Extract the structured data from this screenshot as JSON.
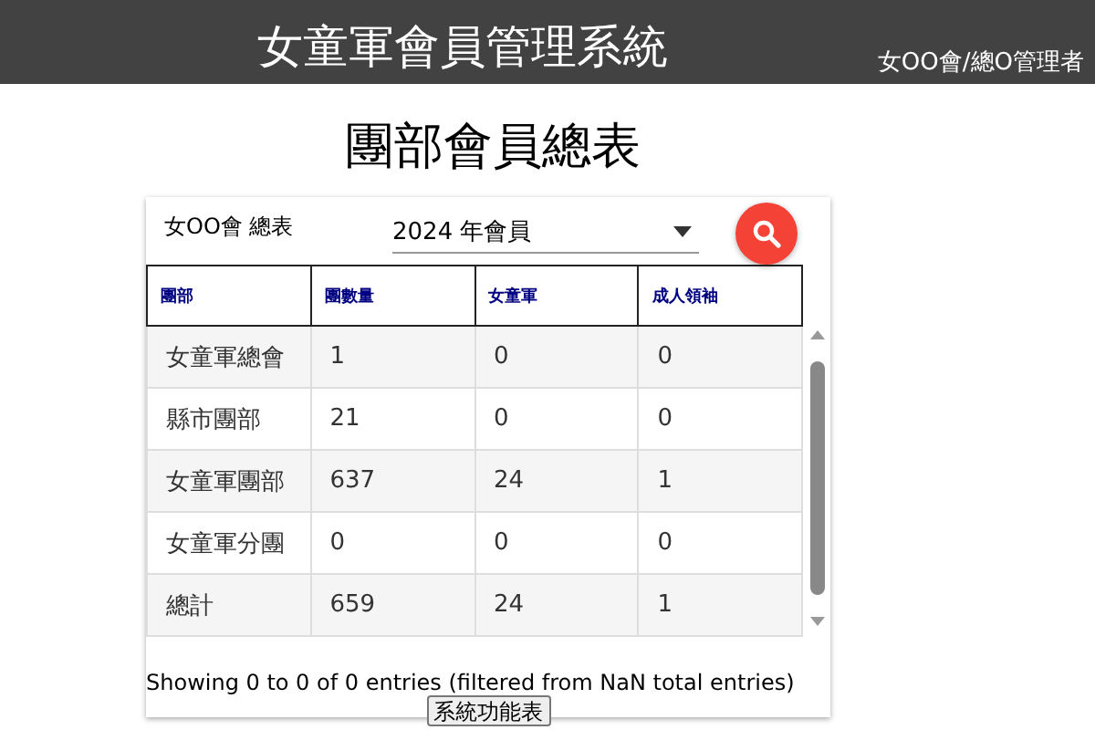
{
  "header": {
    "title": "女童軍會員管理系統",
    "user": "女OO會/總O管理者"
  },
  "page_title": "團部會員總表",
  "filter": {
    "label": "女OO會 總表",
    "select_value": "2024 年會員"
  },
  "table": {
    "columns": [
      "團部",
      "團數量",
      "女童軍",
      "成人領袖"
    ],
    "rows": [
      [
        "女童軍總會",
        "1",
        "0",
        "0"
      ],
      [
        "縣市團部",
        "21",
        "0",
        "0"
      ],
      [
        "女童軍團部",
        "637",
        "24",
        "1"
      ],
      [
        "女童軍分團",
        "0",
        "0",
        "0"
      ],
      [
        "總計",
        "659",
        "24",
        "1"
      ]
    ]
  },
  "info": "Showing 0 to 0 of 0 entries (filtered from NaN total entries)",
  "menu_button": "系統功能表"
}
